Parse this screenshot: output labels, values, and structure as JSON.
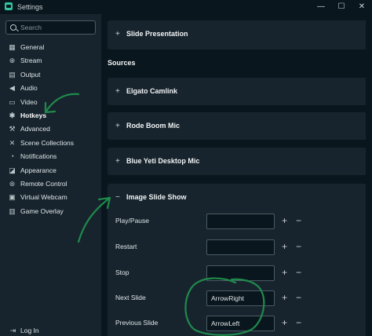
{
  "window": {
    "title": "Settings",
    "controls": {
      "minimize": "—",
      "maximize": "☐",
      "close": "✕"
    }
  },
  "search": {
    "placeholder": "Search"
  },
  "sidebar": {
    "items": [
      {
        "label": "General",
        "icon": "grid-icon",
        "glyph": "▦"
      },
      {
        "label": "Stream",
        "icon": "globe-icon",
        "glyph": "⊕"
      },
      {
        "label": "Output",
        "icon": "output-icon",
        "glyph": "▤"
      },
      {
        "label": "Audio",
        "icon": "speaker-icon",
        "glyph": "◀"
      },
      {
        "label": "Video",
        "icon": "video-icon",
        "glyph": "▭"
      },
      {
        "label": "Hotkeys",
        "icon": "gear-icon",
        "glyph": "✱",
        "active": true
      },
      {
        "label": "Advanced",
        "icon": "wrench-icon",
        "glyph": "⚒"
      },
      {
        "label": "Scene Collections",
        "icon": "collection-icon",
        "glyph": "✕"
      },
      {
        "label": "Notifications",
        "icon": "bell-icon",
        "glyph": "◔"
      },
      {
        "label": "Appearance",
        "icon": "palette-icon",
        "glyph": "◪"
      },
      {
        "label": "Remote Control",
        "icon": "remote-icon",
        "glyph": "⊛"
      },
      {
        "label": "Virtual Webcam",
        "icon": "camera-icon",
        "glyph": "▣"
      },
      {
        "label": "Game Overlay",
        "icon": "gamepad-icon",
        "glyph": "▥"
      }
    ],
    "logout_label": "Log In",
    "logout_glyph": "⇥"
  },
  "main": {
    "top_panel": {
      "title": "Slide Presentation",
      "toggle": "+"
    },
    "sources_label": "Sources",
    "panels": [
      {
        "title": "Elgato Camlink",
        "toggle": "+"
      },
      {
        "title": "Rode Boom Mic",
        "toggle": "+"
      },
      {
        "title": "Blue Yeti Desktop Mic",
        "toggle": "+"
      }
    ],
    "expanded": {
      "title": "Image Slide Show",
      "toggle": "−",
      "hotkeys": [
        {
          "label": "Play/Pause",
          "value": ""
        },
        {
          "label": "Restart",
          "value": ""
        },
        {
          "label": "Stop",
          "value": ""
        },
        {
          "label": "Next Slide",
          "value": "ArrowRight"
        },
        {
          "label": "Previous Slide",
          "value": "ArrowLeft"
        }
      ],
      "add_glyph": "+",
      "remove_glyph": "−"
    }
  },
  "annotations": {
    "ink_color": "#1f8a4c"
  }
}
